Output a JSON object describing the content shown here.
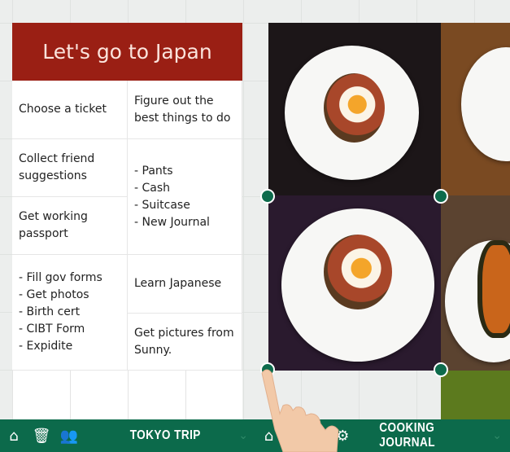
{
  "card": {
    "title": "Let's go to Japan",
    "left": [
      "Choose a ticket",
      "Collect friend\nsuggestions",
      "Get working\npassport",
      "- Fill gov forms\n- Get photos\n- Birth cert\n- CIBT Form\n- Expidite"
    ],
    "right": [
      "Figure out the\nbest things to do",
      "- Pants\n- Cash\n- Suitcase\n- New Journal",
      "Learn Japanese",
      "Get pictures from\nSunny."
    ]
  },
  "toolbar_left": {
    "title": "TOKYO TRIP",
    "icons": [
      "home-icon",
      "trash-icon",
      "people-icon"
    ]
  },
  "toolbar_right": {
    "title": "COOKING JOURNAL",
    "icons": [
      "home-icon",
      "gear-icon"
    ]
  },
  "colors": {
    "accent_red": "#9a1f14",
    "toolbar_green": "#0c6a4b"
  }
}
